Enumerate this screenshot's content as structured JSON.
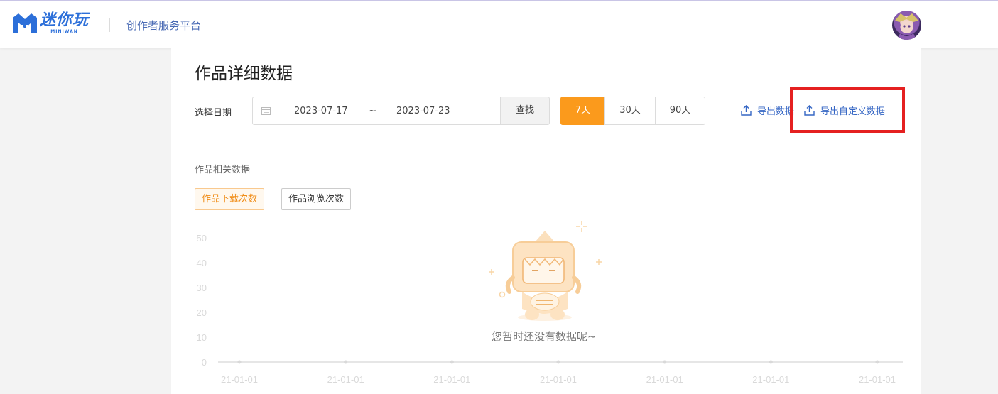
{
  "header": {
    "logo_title": "迷你玩",
    "logo_subtitle": "MINIWAN",
    "platform_name": "创作者服务平台"
  },
  "page": {
    "title": "作品详细数据",
    "date_label": "选择日期",
    "date_start": "2023-07-17",
    "date_separator": "~",
    "date_end": "2023-07-23",
    "search_label": "查找",
    "ranges": [
      {
        "label": "7天",
        "active": true
      },
      {
        "label": "30天",
        "active": false
      },
      {
        "label": "90天",
        "active": false
      }
    ],
    "export_label": "导出数据",
    "export_custom_label": "导出自定义数据",
    "section_label": "作品相关数据",
    "metrics": [
      {
        "label": "作品下载次数",
        "active": true
      },
      {
        "label": "作品浏览次数",
        "active": false
      }
    ],
    "empty_text": "您暂时还没有数据呢~"
  },
  "chart_data": {
    "type": "line",
    "categories": [
      "21-01-01",
      "21-01-01",
      "21-01-01",
      "21-01-01",
      "21-01-01",
      "21-01-01",
      "21-01-01"
    ],
    "series": [],
    "y_ticks": [
      "50",
      "40",
      "30",
      "20",
      "10",
      "0"
    ],
    "ylim": [
      0,
      50
    ],
    "grid": false
  },
  "colors": {
    "accent": "#fb9a1c",
    "link": "#3566c4",
    "highlight": "#e52020"
  }
}
